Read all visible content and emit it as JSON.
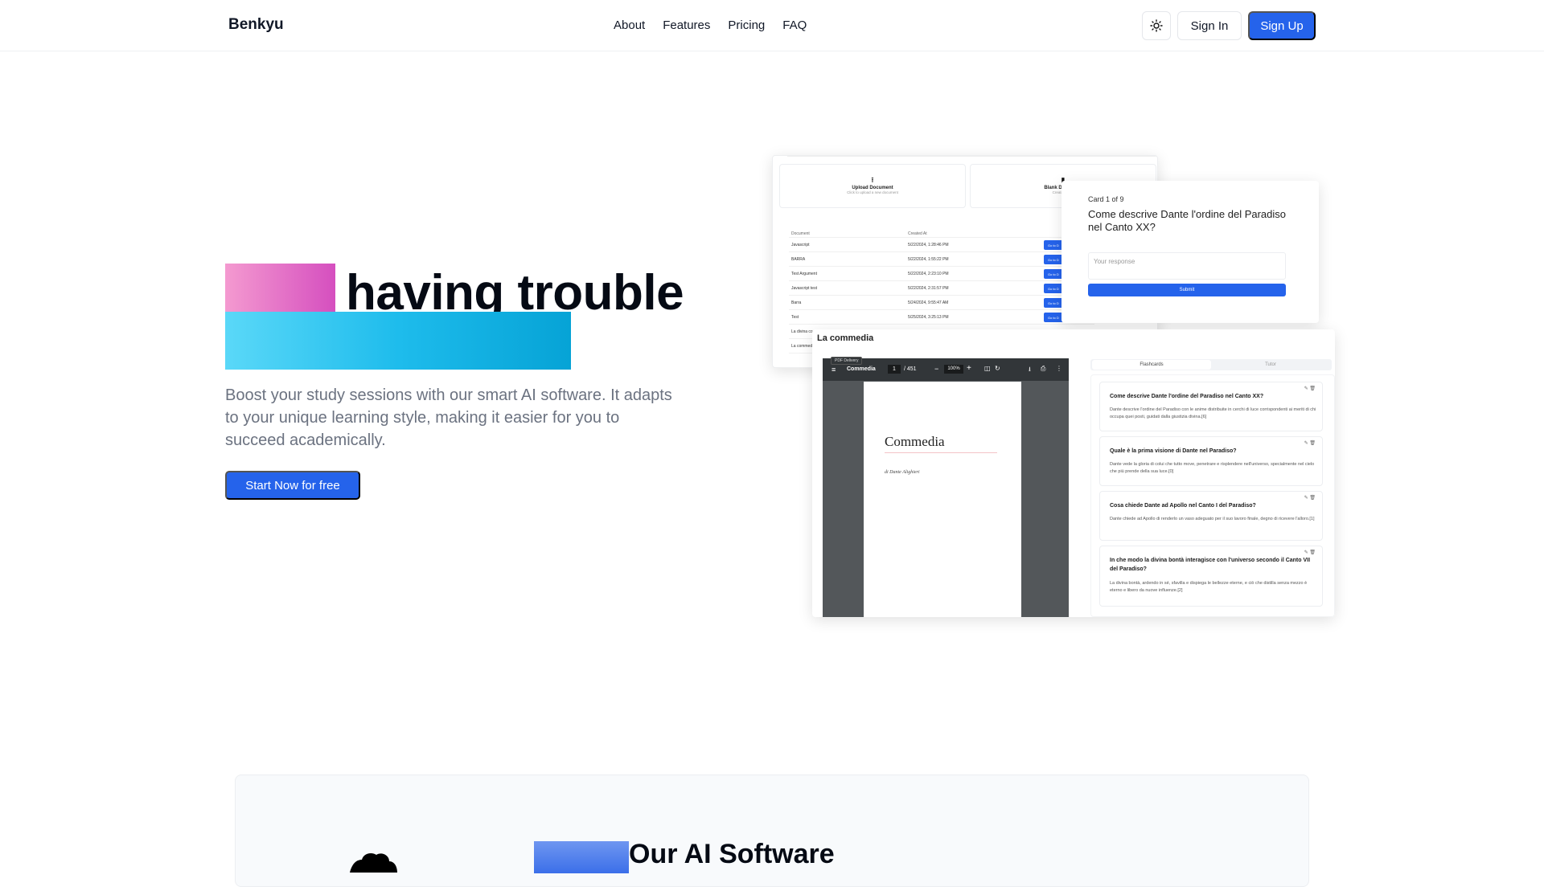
{
  "nav": {
    "brand": "Benkyu",
    "links": [
      "About",
      "Features",
      "Pricing",
      "FAQ"
    ],
    "theme_icon": "sun-icon",
    "signin_label": "Sign In",
    "signup_label": "Sign Up"
  },
  "hero": {
    "title": "having trouble",
    "subtitle": "Boost your study sessions with our smart AI software. It adapts to your unique learning style, making it easier for you to succeed academically.",
    "cta_label": "Start Now for free"
  },
  "preview_docs": {
    "upload_title": "Upload Document",
    "upload_sub": "Click to upload a new document",
    "blank_title": "Blank Document",
    "blank_sub": "Create a new",
    "columns": [
      "Document",
      "Created At"
    ],
    "rows": [
      {
        "name": "Javascript",
        "created": "5/22/2024, 1:28:46 PM",
        "action": "Go to D"
      },
      {
        "name": "BARRA",
        "created": "5/22/2024, 1:55:22 PM",
        "action": "Go to D"
      },
      {
        "name": "Test Argument",
        "created": "5/22/2024, 2:23:10 PM",
        "action": "Go to D"
      },
      {
        "name": "Javascript test",
        "created": "5/22/2024, 2:31:57 PM",
        "action": "Go to D"
      },
      {
        "name": "Barra",
        "created": "5/24/2024, 9:55:47 AM",
        "action": "Go to D"
      },
      {
        "name": "Test",
        "created": "5/25/2024, 3:25:13 PM",
        "action": "Go to D"
      },
      {
        "name": "La divina co",
        "created": "",
        "action": ""
      },
      {
        "name": "La commed",
        "created": "",
        "action": ""
      }
    ]
  },
  "preview_card": {
    "counter": "Card 1 of 9",
    "question": "Come descrive Dante l'ordine del Paradiso nel Canto XX?",
    "response_placeholder": "Your response",
    "submit_label": "Submit"
  },
  "preview_commedia": {
    "title": "La commedia",
    "pdf": {
      "tag": "PDF Delivery",
      "doc_title": "Commedia",
      "page": "1",
      "page_total": "/ 451",
      "zoom": "100%",
      "page_heading": "Commedia",
      "page_author": "di Dante Alighieri"
    },
    "tabs": [
      "Flashcards",
      "Tutor"
    ],
    "flashcards": [
      {
        "q": "Come descrive Dante l'ordine del Paradiso nel Canto XX?",
        "a": "Dante descrive l'ordine del Paradiso con le anime distribuite in cerchi di luce corrispondenti ai meriti di chi occupa quei posti, guidati dalla giustizia divina.[6]"
      },
      {
        "q": "Quale è la prima visione di Dante nel Paradiso?",
        "a": "Dante vede la gloria di colui che tutto move, penetrare e risplendere nell'universo, specialmente nel cielo che più prende della sua luce.[0]"
      },
      {
        "q": "Cosa chiede Dante ad Apollo nel Canto I del Paradiso?",
        "a": "Dante chiede ad Apollo di renderlo un vaso adeguato per il suo lavoro finale, degno di ricevere l'alloro.[1]"
      },
      {
        "q": "In che modo la divina bontà interagisce con l'universo secondo il Canto VII del Paradiso?",
        "a": "La divina bontà, ardendo in sé, sfavilla e dispiega le bellezze eterne, e ciò che distilla senza mezzo è eterno e libero da nuove influenze.[2]"
      }
    ]
  },
  "feature": {
    "title": "Our AI Software"
  },
  "colors": {
    "accent": "#2563eb",
    "pink_start": "#f49ad0",
    "pink_end": "#d54fbf",
    "cyan_start": "#5ad8f8",
    "cyan_end": "#06a3d6"
  }
}
